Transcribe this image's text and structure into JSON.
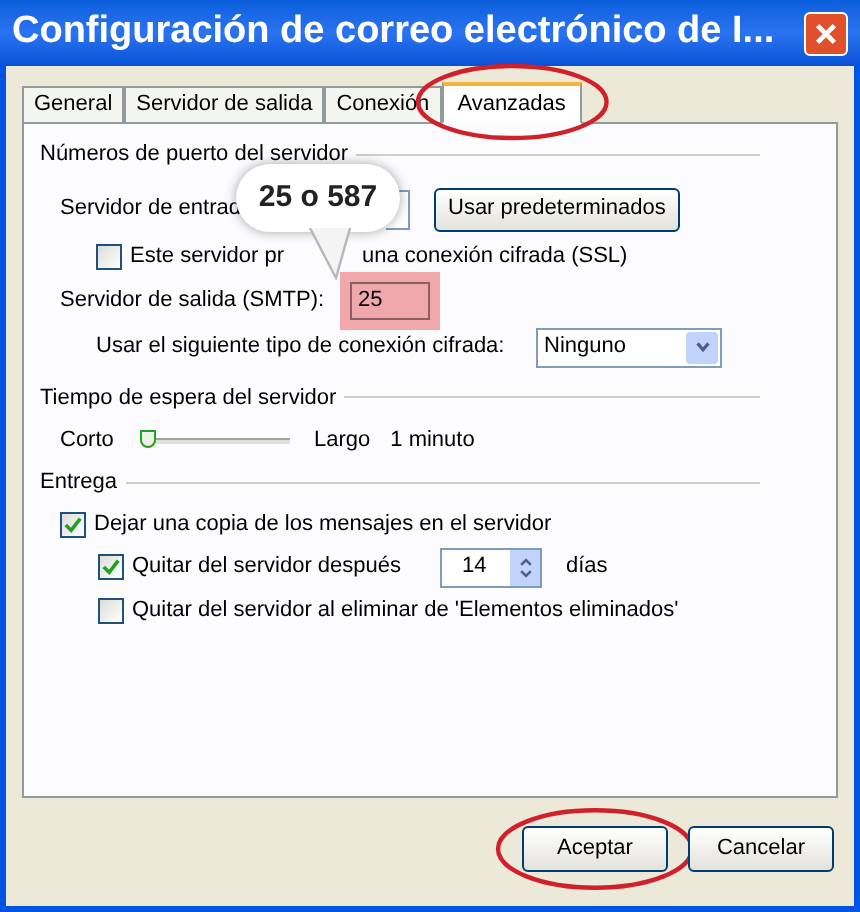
{
  "window": {
    "title": "Configuración de correo electrónico de I..."
  },
  "tabs": [
    {
      "label": "General",
      "selected": false,
      "circled": false
    },
    {
      "label": "Servidor de salida",
      "selected": false,
      "circled": false
    },
    {
      "label": "Conexión",
      "selected": false,
      "circled": false
    },
    {
      "label": "Avanzadas",
      "selected": true,
      "circled": true
    }
  ],
  "ports": {
    "section": "Números de puerto del servidor",
    "incoming_label": "Servidor de entrad",
    "defaults_button": "Usar predeterminados",
    "ssl": {
      "label_start": "Este servidor pr",
      "label_end": "una conexión cifrada (SSL)",
      "checked": false
    },
    "smtp": {
      "label": "Servidor de salida (SMTP):",
      "value": "25",
      "highlighted": true
    },
    "encryption": {
      "label": "Usar el siguiente tipo de conexión cifrada:",
      "value": "Ninguno"
    }
  },
  "callout": {
    "text": "25 o 587"
  },
  "timeout": {
    "section": "Tiempo de espera del servidor",
    "min_label": "Corto",
    "max_label": "Largo",
    "reading": "1 minuto",
    "level": 0.05
  },
  "delivery": {
    "section": "Entrega",
    "leave_copy": {
      "label": "Dejar una copia de los mensajes en el servidor",
      "checked": true
    },
    "remove_after": {
      "label": "Quitar del servidor después",
      "checked": true,
      "value": "14",
      "unit": "días"
    },
    "remove_on_delete": {
      "label": "Quitar del servidor al eliminar de 'Elementos eliminados'",
      "checked": false
    }
  },
  "buttons": [
    {
      "label": "Aceptar",
      "circled": true
    },
    {
      "label": "Cancelar",
      "circled": false
    }
  ]
}
